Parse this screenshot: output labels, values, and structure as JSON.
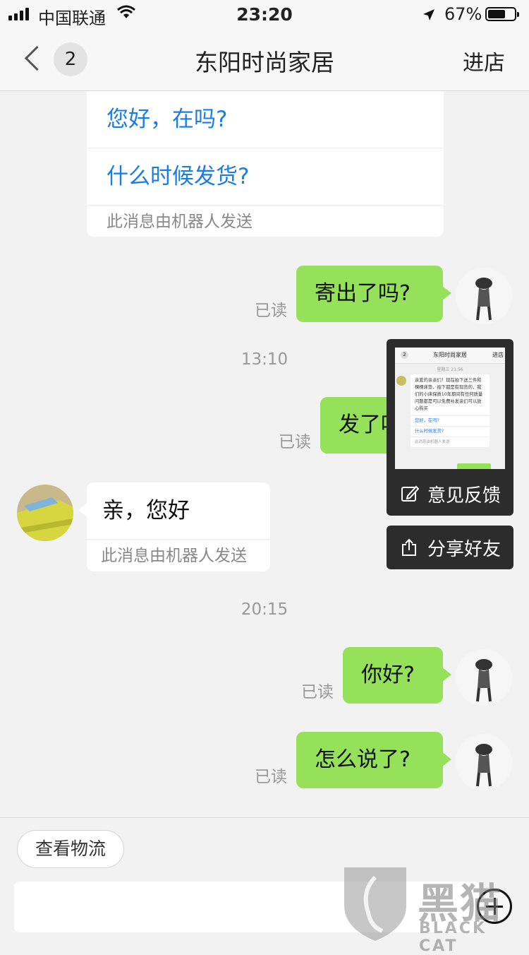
{
  "status_bar": {
    "carrier": "中国联通",
    "time": "23:20",
    "battery": "67%",
    "battery_level": 0.67
  },
  "nav": {
    "badge_count": "2",
    "title": "东阳时尚家居",
    "action": "进店"
  },
  "chat": {
    "bot_card": {
      "options": [
        "您好，在吗?",
        "什么时候发货?"
      ],
      "footer": "此消息由机器人发送"
    },
    "messages": [
      {
        "text": "寄出了吗?",
        "status": "已读"
      },
      {
        "time": "13:10"
      },
      {
        "text": "发了吗",
        "status": "已读"
      },
      {
        "text": "亲，您好",
        "footer": "此消息由机器人发送"
      },
      {
        "time": "20:15"
      },
      {
        "text": "你好?",
        "status": "已读"
      },
      {
        "text": "怎么说了?",
        "status": "已读"
      }
    ]
  },
  "popup": {
    "thumbnail": {
      "title": "东阳时尚家居",
      "badge": "2",
      "action": "进店",
      "time": "星期三 21:56",
      "message": "亲爱的亲亲们！现在拍下送三件和棵棵床垫，拍下都是有现货的，我们的小床保质10年期间有任何质量问题都是可以免费补发亲们可以放心购买",
      "options": [
        "您好，在吗?",
        "什么时候发货?"
      ],
      "footer": "此消息由机器人发送"
    },
    "feedback": "意见反馈",
    "share": "分享好友"
  },
  "bottom": {
    "logistics": "查看物流",
    "input_value": ""
  },
  "watermark": {
    "cn": "黑猫",
    "en": "BLACK CAT"
  },
  "colors": {
    "my_bubble": "#95e15a",
    "link": "#1a7de6",
    "popup_bg": "#2c2c2c"
  }
}
